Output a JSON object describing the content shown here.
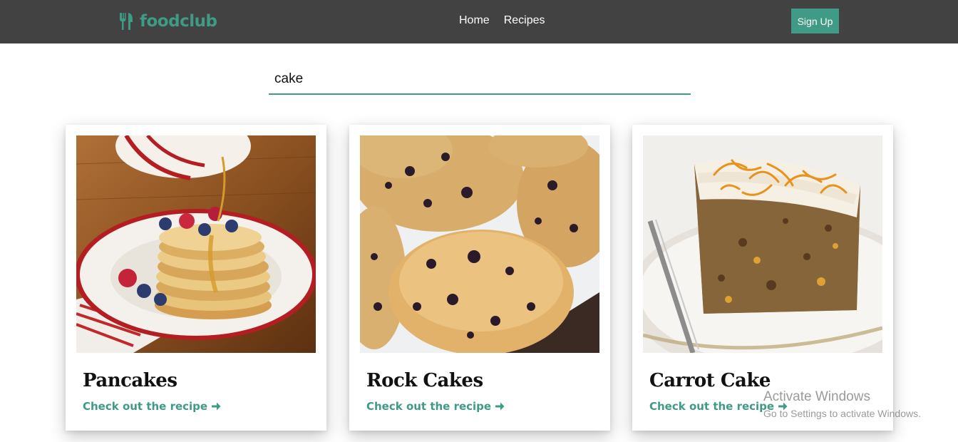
{
  "nav": {
    "logo_text": "foodclub",
    "logo_icon": "fork-spoon-icon",
    "links": [
      "Home",
      "Recipes"
    ],
    "signup_label": "Sign Up"
  },
  "search": {
    "value": "cake",
    "placeholder": ""
  },
  "cards": [
    {
      "title": "Pancakes",
      "link": "Check out the recipe",
      "image": "pancakes-photo"
    },
    {
      "title": "Rock Cakes",
      "link": "Check out the recipe",
      "image": "rock-cakes-photo"
    },
    {
      "title": "Carrot Cake",
      "link": "Check out the recipe",
      "image": "carrot-cake-photo"
    }
  ],
  "watermark": {
    "title": "Activate Windows",
    "subtitle": "Go to Settings to activate Windows."
  },
  "colors": {
    "navbar": "#424242",
    "accent": "#3f9a86"
  }
}
